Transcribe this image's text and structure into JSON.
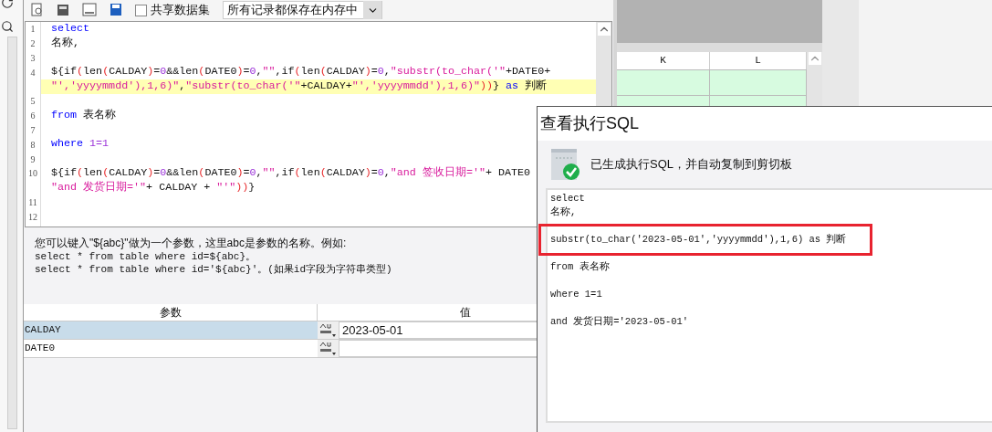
{
  "toolbar": {
    "share_dataset": {
      "label": "共享数据集",
      "checked": false
    },
    "storage_mode": "所有记录都保存在内存中"
  },
  "editor": {
    "lines": [
      {
        "number": "1",
        "rows": [
          {
            "highlighted": false,
            "segments": [
              {
                "kind": "keyword",
                "text": "select"
              }
            ]
          }
        ]
      },
      {
        "number": "2",
        "rows": [
          {
            "highlighted": false,
            "segments": [
              {
                "kind": "plain",
                "text": "名称,"
              }
            ]
          }
        ]
      },
      {
        "number": "3"
      },
      {
        "number": "4",
        "rows": [
          {
            "highlighted": false,
            "segments": [
              {
                "kind": "plain",
                "text": "${if"
              },
              {
                "kind": "paren",
                "text": "("
              },
              {
                "kind": "plain",
                "text": "len"
              },
              {
                "kind": "paren",
                "text": "("
              },
              {
                "kind": "plain",
                "text": "CALDAY"
              },
              {
                "kind": "paren",
                "text": ")"
              },
              {
                "kind": "plain",
                "text": "="
              },
              {
                "kind": "number",
                "text": "0"
              },
              {
                "kind": "plain",
                "text": "&&len"
              },
              {
                "kind": "paren",
                "text": "("
              },
              {
                "kind": "plain",
                "text": "DATE0"
              },
              {
                "kind": "paren",
                "text": ")"
              },
              {
                "kind": "plain",
                "text": "="
              },
              {
                "kind": "number",
                "text": "0"
              },
              {
                "kind": "plain",
                "text": ","
              },
              {
                "kind": "string",
                "text": "\"\""
              },
              {
                "kind": "plain",
                "text": ",if"
              },
              {
                "kind": "paren",
                "text": "("
              },
              {
                "kind": "plain",
                "text": "len"
              },
              {
                "kind": "paren",
                "text": "("
              },
              {
                "kind": "plain",
                "text": "CALDAY"
              },
              {
                "kind": "paren",
                "text": ")"
              },
              {
                "kind": "plain",
                "text": "="
              },
              {
                "kind": "number",
                "text": "0"
              },
              {
                "kind": "plain",
                "text": ","
              },
              {
                "kind": "string",
                "text": "\"substr(to_char('\""
              },
              {
                "kind": "plain",
                "text": "+DATE0+"
              }
            ]
          },
          {
            "highlighted": true,
            "segments": [
              {
                "kind": "string",
                "text": "\"','yyyymmdd'),1,6)\""
              },
              {
                "kind": "plain",
                "text": ","
              },
              {
                "kind": "string",
                "text": "\"substr(to_char('\""
              },
              {
                "kind": "plain",
                "text": "+CALDAY+"
              },
              {
                "kind": "string",
                "text": "\"','yyyymmdd'),1,6)\""
              },
              {
                "kind": "paren",
                "text": "))"
              },
              {
                "kind": "plain",
                "text": "} "
              },
              {
                "kind": "keyword",
                "text": "as"
              },
              {
                "kind": "plain",
                "text": " 判断"
              }
            ]
          }
        ]
      },
      {
        "number": "5"
      },
      {
        "number": "6",
        "rows": [
          {
            "highlighted": false,
            "segments": [
              {
                "kind": "keyword",
                "text": "from"
              },
              {
                "kind": "plain",
                "text": " 表名称"
              }
            ]
          }
        ]
      },
      {
        "number": "7"
      },
      {
        "number": "8",
        "rows": [
          {
            "highlighted": false,
            "segments": [
              {
                "kind": "keyword",
                "text": "where"
              },
              {
                "kind": "number",
                "text": " 1=1"
              }
            ]
          }
        ]
      },
      {
        "number": "9"
      },
      {
        "number": "10",
        "rows": [
          {
            "highlighted": false,
            "segments": [
              {
                "kind": "plain",
                "text": "${if"
              },
              {
                "kind": "paren",
                "text": "("
              },
              {
                "kind": "plain",
                "text": "len"
              },
              {
                "kind": "paren",
                "text": "("
              },
              {
                "kind": "plain",
                "text": "CALDAY"
              },
              {
                "kind": "paren",
                "text": ")"
              },
              {
                "kind": "plain",
                "text": "="
              },
              {
                "kind": "number",
                "text": "0"
              },
              {
                "kind": "plain",
                "text": "&&len"
              },
              {
                "kind": "paren",
                "text": "("
              },
              {
                "kind": "plain",
                "text": "DATE0"
              },
              {
                "kind": "paren",
                "text": ")"
              },
              {
                "kind": "plain",
                "text": "="
              },
              {
                "kind": "number",
                "text": "0"
              },
              {
                "kind": "plain",
                "text": ","
              },
              {
                "kind": "string",
                "text": "\"\""
              },
              {
                "kind": "plain",
                "text": ",if"
              },
              {
                "kind": "paren",
                "text": "("
              },
              {
                "kind": "plain",
                "text": "len"
              },
              {
                "kind": "paren",
                "text": "("
              },
              {
                "kind": "plain",
                "text": "CALDAY"
              },
              {
                "kind": "paren",
                "text": ")"
              },
              {
                "kind": "plain",
                "text": "="
              },
              {
                "kind": "number",
                "text": "0"
              },
              {
                "kind": "plain",
                "text": ","
              },
              {
                "kind": "string",
                "text": "\"and 签收日期='\""
              },
              {
                "kind": "plain",
                "text": "+ DATE0"
              }
            ]
          },
          {
            "highlighted": false,
            "segments": [
              {
                "kind": "string",
                "text": "\"and 发货日期='\""
              },
              {
                "kind": "plain",
                "text": "+ CALDAY + "
              },
              {
                "kind": "string",
                "text": "\"'\""
              },
              {
                "kind": "paren",
                "text": "))"
              },
              {
                "kind": "plain",
                "text": "}"
              }
            ]
          }
        ]
      },
      {
        "number": "11"
      },
      {
        "number": "12"
      }
    ]
  },
  "help": {
    "intro": "您可以键入\"${abc}\"做为一个参数，这里abc是参数的名称。例如:",
    "examples": [
      "select * from table where id=${abc}。",
      "select * from table where id='${abc}'。(如果id字段为字符串类型)"
    ]
  },
  "parameters": {
    "columns": [
      "参数",
      "值"
    ],
    "rows": [
      {
        "name": "CALDAY",
        "value": "2023-05-01",
        "selected": true
      },
      {
        "name": "DATE0",
        "selected": false
      }
    ]
  },
  "sheet": {
    "columns": [
      "K",
      "L"
    ]
  },
  "dialog": {
    "title": "查看执行SQL",
    "message": "已生成执行SQL，并自动复制到剪切板",
    "sql_lines": [
      {
        "kind": "text",
        "text": "select",
        "highlighted": false
      },
      {
        "kind": "text",
        "text": "名称,",
        "highlighted": false
      },
      {
        "kind": "blank"
      },
      {
        "kind": "text",
        "text": "substr(to_char('2023-05-01','yyyymmdd'),1,6) as 判断",
        "highlighted": true
      },
      {
        "kind": "blank"
      },
      {
        "kind": "text",
        "text": "from 表名称",
        "highlighted": false
      },
      {
        "kind": "blank"
      },
      {
        "kind": "text",
        "text": "where 1=1",
        "highlighted": false
      },
      {
        "kind": "blank"
      },
      {
        "kind": "text",
        "text": "and 发货日期='2023-05-01'",
        "highlighted": false
      }
    ]
  }
}
